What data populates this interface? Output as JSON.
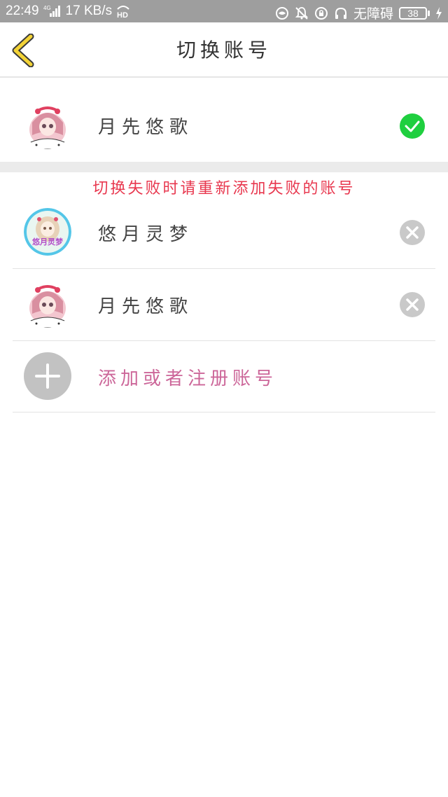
{
  "status_bar": {
    "time": "22:49",
    "network": "4G",
    "speed": "17 KB/s",
    "hd": "HD",
    "mode": "无障碍",
    "battery": "38"
  },
  "header": {
    "title": "切换账号",
    "back_icon": "chevron-left-icon"
  },
  "current_account": {
    "name": "月先悠歌",
    "status_icon": "check-circle-icon",
    "status_color": "#1fcf3f"
  },
  "hint": {
    "text": "切换失败时请重新添加失败的账号",
    "color": "#e8384f"
  },
  "accounts": [
    {
      "name": "悠月灵梦",
      "avatar_label": "悠月灵梦",
      "action_icon": "close-circle-icon"
    },
    {
      "name": "月先悠歌",
      "action_icon": "close-circle-icon"
    }
  ],
  "add_account": {
    "label": "添加或者注册账号",
    "icon": "plus-icon",
    "color": "#cc6699"
  }
}
